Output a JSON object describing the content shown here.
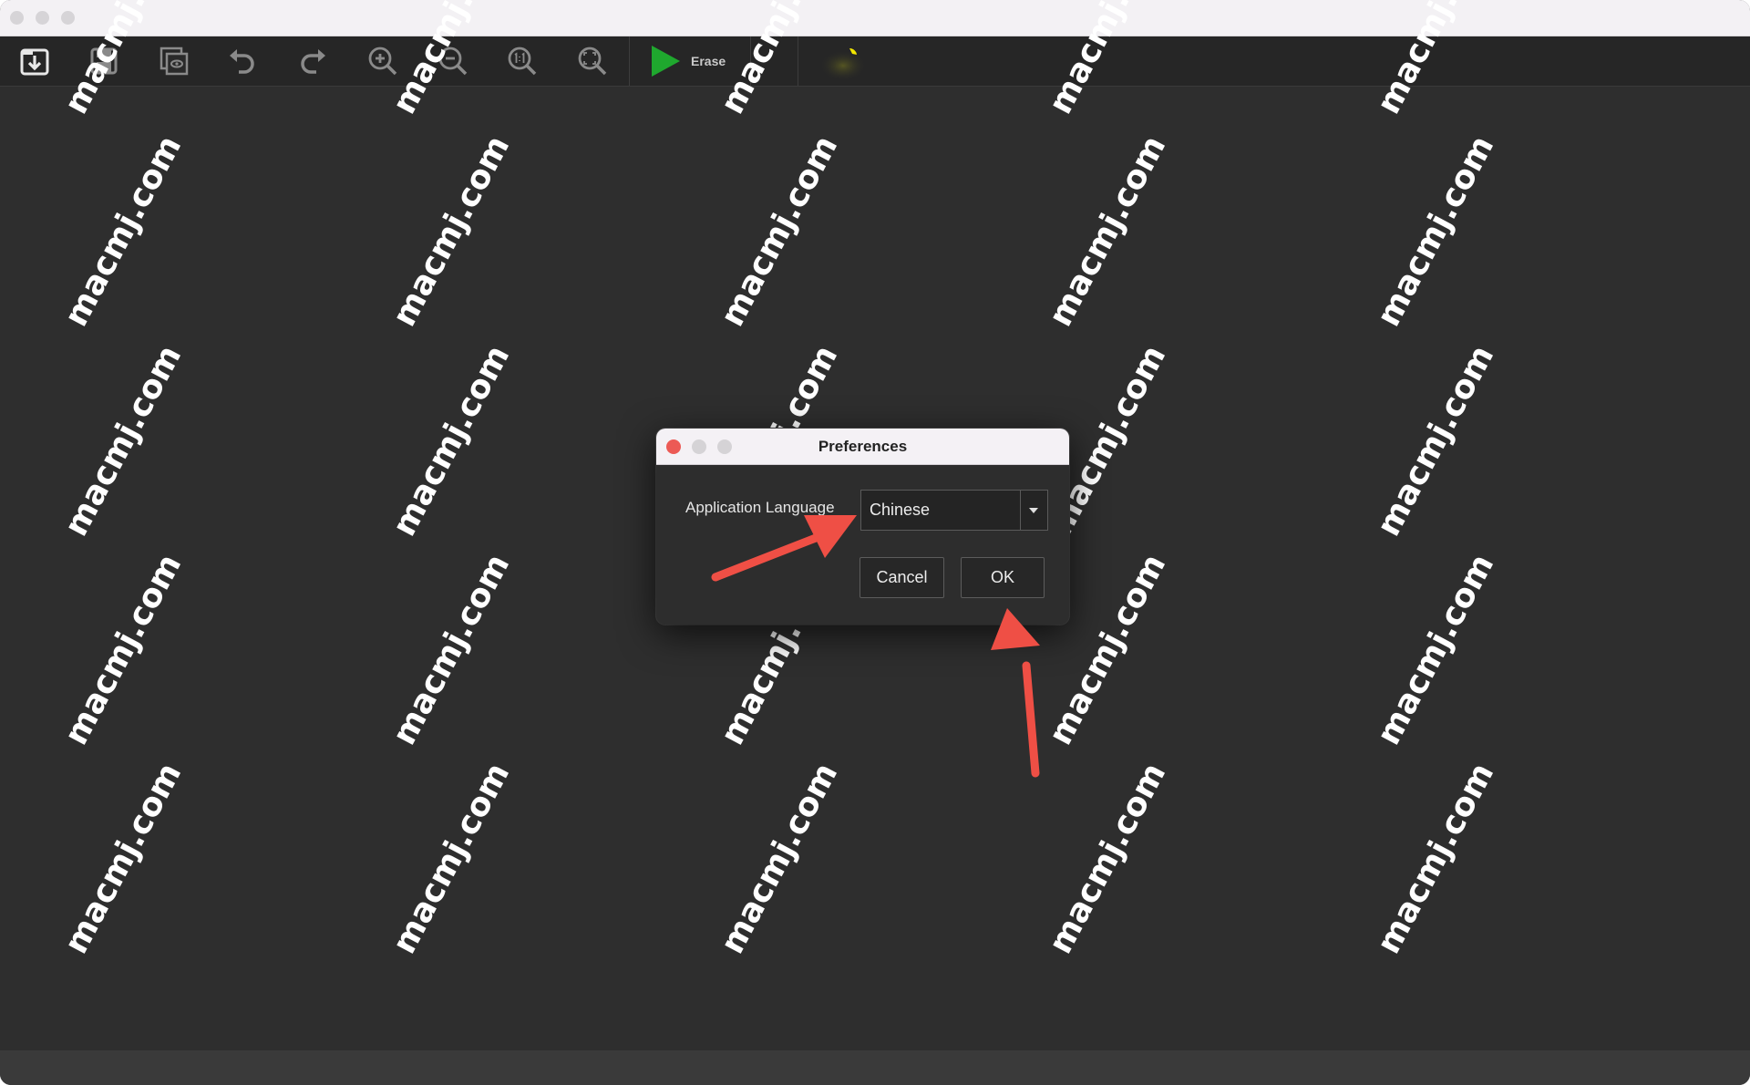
{
  "window": {
    "title": ""
  },
  "toolbar": {
    "tools": [
      "open-icon",
      "save-icon",
      "preview-icon",
      "undo-icon",
      "redo-icon",
      "zoom-in-icon",
      "zoom-out-icon",
      "actual-size-icon",
      "fit-window-icon"
    ],
    "erase_label": "Erase"
  },
  "dialog": {
    "title": "Preferences",
    "language_label": "Application Language",
    "language_value": "Chinese",
    "cancel_label": "Cancel",
    "ok_label": "OK"
  },
  "watermark": {
    "text": "macmj.com"
  },
  "colors": {
    "canvas": "#2e2e2e",
    "toolbar": "#262626",
    "play": "#1fa82e",
    "annotation_arrow": "#ef4f45",
    "close_dot": "#ec5a55"
  }
}
